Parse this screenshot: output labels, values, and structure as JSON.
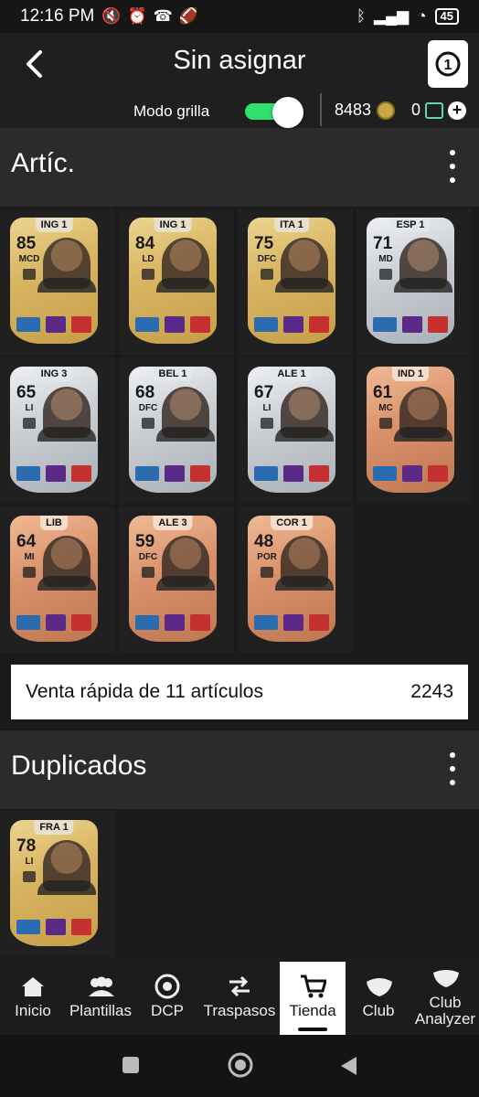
{
  "status": {
    "time": "12:16 PM",
    "battery": "45"
  },
  "header": {
    "title": "Sin asignar",
    "grid_mode_label": "Modo grilla",
    "grid_mode_on": true,
    "coins": "8483",
    "points": "0"
  },
  "sections": {
    "items_title": "Artíc.",
    "duplicates_title": "Duplicados"
  },
  "cards": [
    {
      "league": "ING 1",
      "rating": "85",
      "position": "MCD",
      "tier": "gold"
    },
    {
      "league": "ING 1",
      "rating": "84",
      "position": "LD",
      "tier": "gold"
    },
    {
      "league": "ITA 1",
      "rating": "75",
      "position": "DFC",
      "tier": "gold"
    },
    {
      "league": "ESP 1",
      "rating": "71",
      "position": "MD",
      "tier": "silver"
    },
    {
      "league": "ING 3",
      "rating": "65",
      "position": "LI",
      "tier": "silver"
    },
    {
      "league": "BEL 1",
      "rating": "68",
      "position": "DFC",
      "tier": "silver"
    },
    {
      "league": "ALE 1",
      "rating": "67",
      "position": "LI",
      "tier": "silver"
    },
    {
      "league": "IND 1",
      "rating": "61",
      "position": "MC",
      "tier": "bronze"
    },
    {
      "league": "LIB",
      "rating": "64",
      "position": "MI",
      "tier": "bronze"
    },
    {
      "league": "ALE 3",
      "rating": "59",
      "position": "DFC",
      "tier": "bronze"
    },
    {
      "league": "COR 1",
      "rating": "48",
      "position": "POR",
      "tier": "bronze"
    }
  ],
  "duplicates": [
    {
      "league": "FRA 1",
      "rating": "78",
      "position": "LI",
      "tier": "gold"
    }
  ],
  "quick_sell": {
    "label": "Venta rápida de 11 artículos",
    "value": "2243"
  },
  "nav": [
    {
      "label": "Inicio",
      "icon": "home-icon"
    },
    {
      "label": "Plantillas",
      "icon": "squad-icon"
    },
    {
      "label": "DCP",
      "icon": "dcp-icon"
    },
    {
      "label": "Traspasos",
      "icon": "transfers-icon"
    },
    {
      "label": "Tienda",
      "icon": "cart-icon",
      "active": true
    },
    {
      "label": "Club",
      "icon": "club-icon"
    },
    {
      "label": "Club Analyzer",
      "icon": "club-analyzer-icon"
    }
  ]
}
